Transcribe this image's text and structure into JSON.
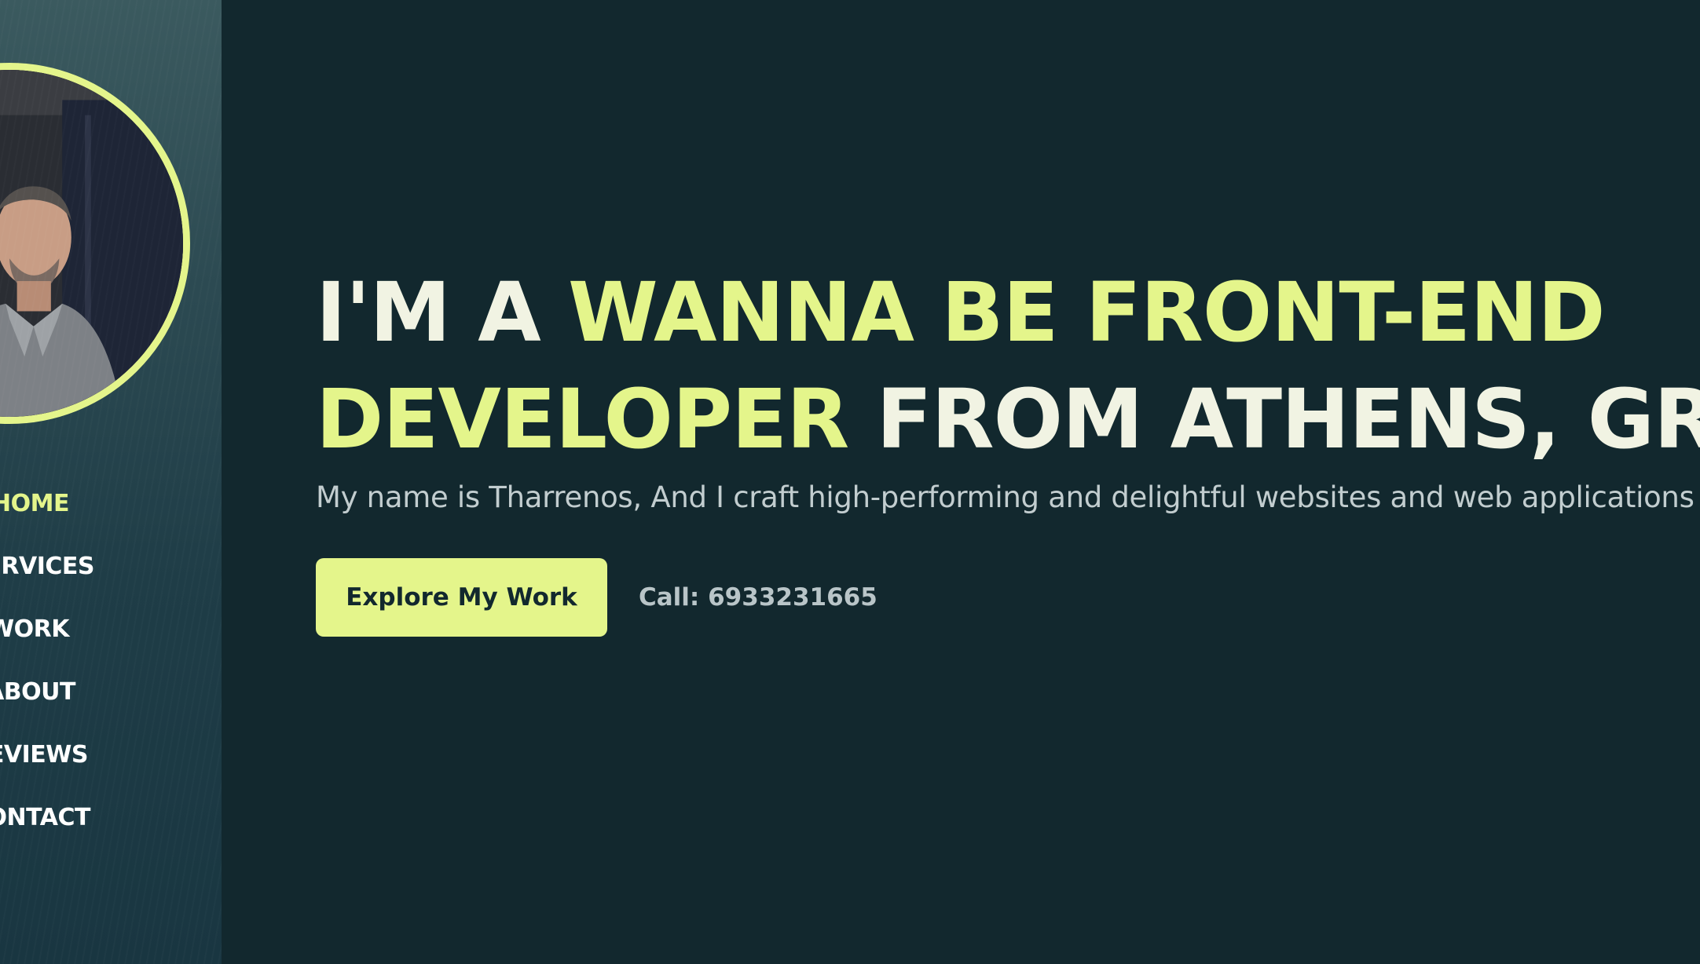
{
  "sidebar": {
    "nav": [
      {
        "label": "HOME",
        "active": true
      },
      {
        "label": "ERVICES",
        "active": false
      },
      {
        "label": "WORK",
        "active": false
      },
      {
        "label": "ABOUT",
        "active": false
      },
      {
        "label": "EVIEWS",
        "active": false
      },
      {
        "label": "ONTACT",
        "active": false
      }
    ]
  },
  "hero": {
    "headline": {
      "part1": "I'M A ",
      "highlight1": "WANNA BE FRONT-END",
      "highlight2": "DEVELOPER",
      "part2": " FROM ATHENS, GR"
    },
    "subtitle": "My name is Tharrenos, And I craft high-performing and delightful websites and web applications",
    "cta_label": "Explore My Work",
    "phone": "Call: 6933231665"
  },
  "colors": {
    "background": "#12282e",
    "accent": "#e4f58b",
    "headline_text": "#f1f3e3",
    "subtitle_text": "#c2cdcf"
  }
}
